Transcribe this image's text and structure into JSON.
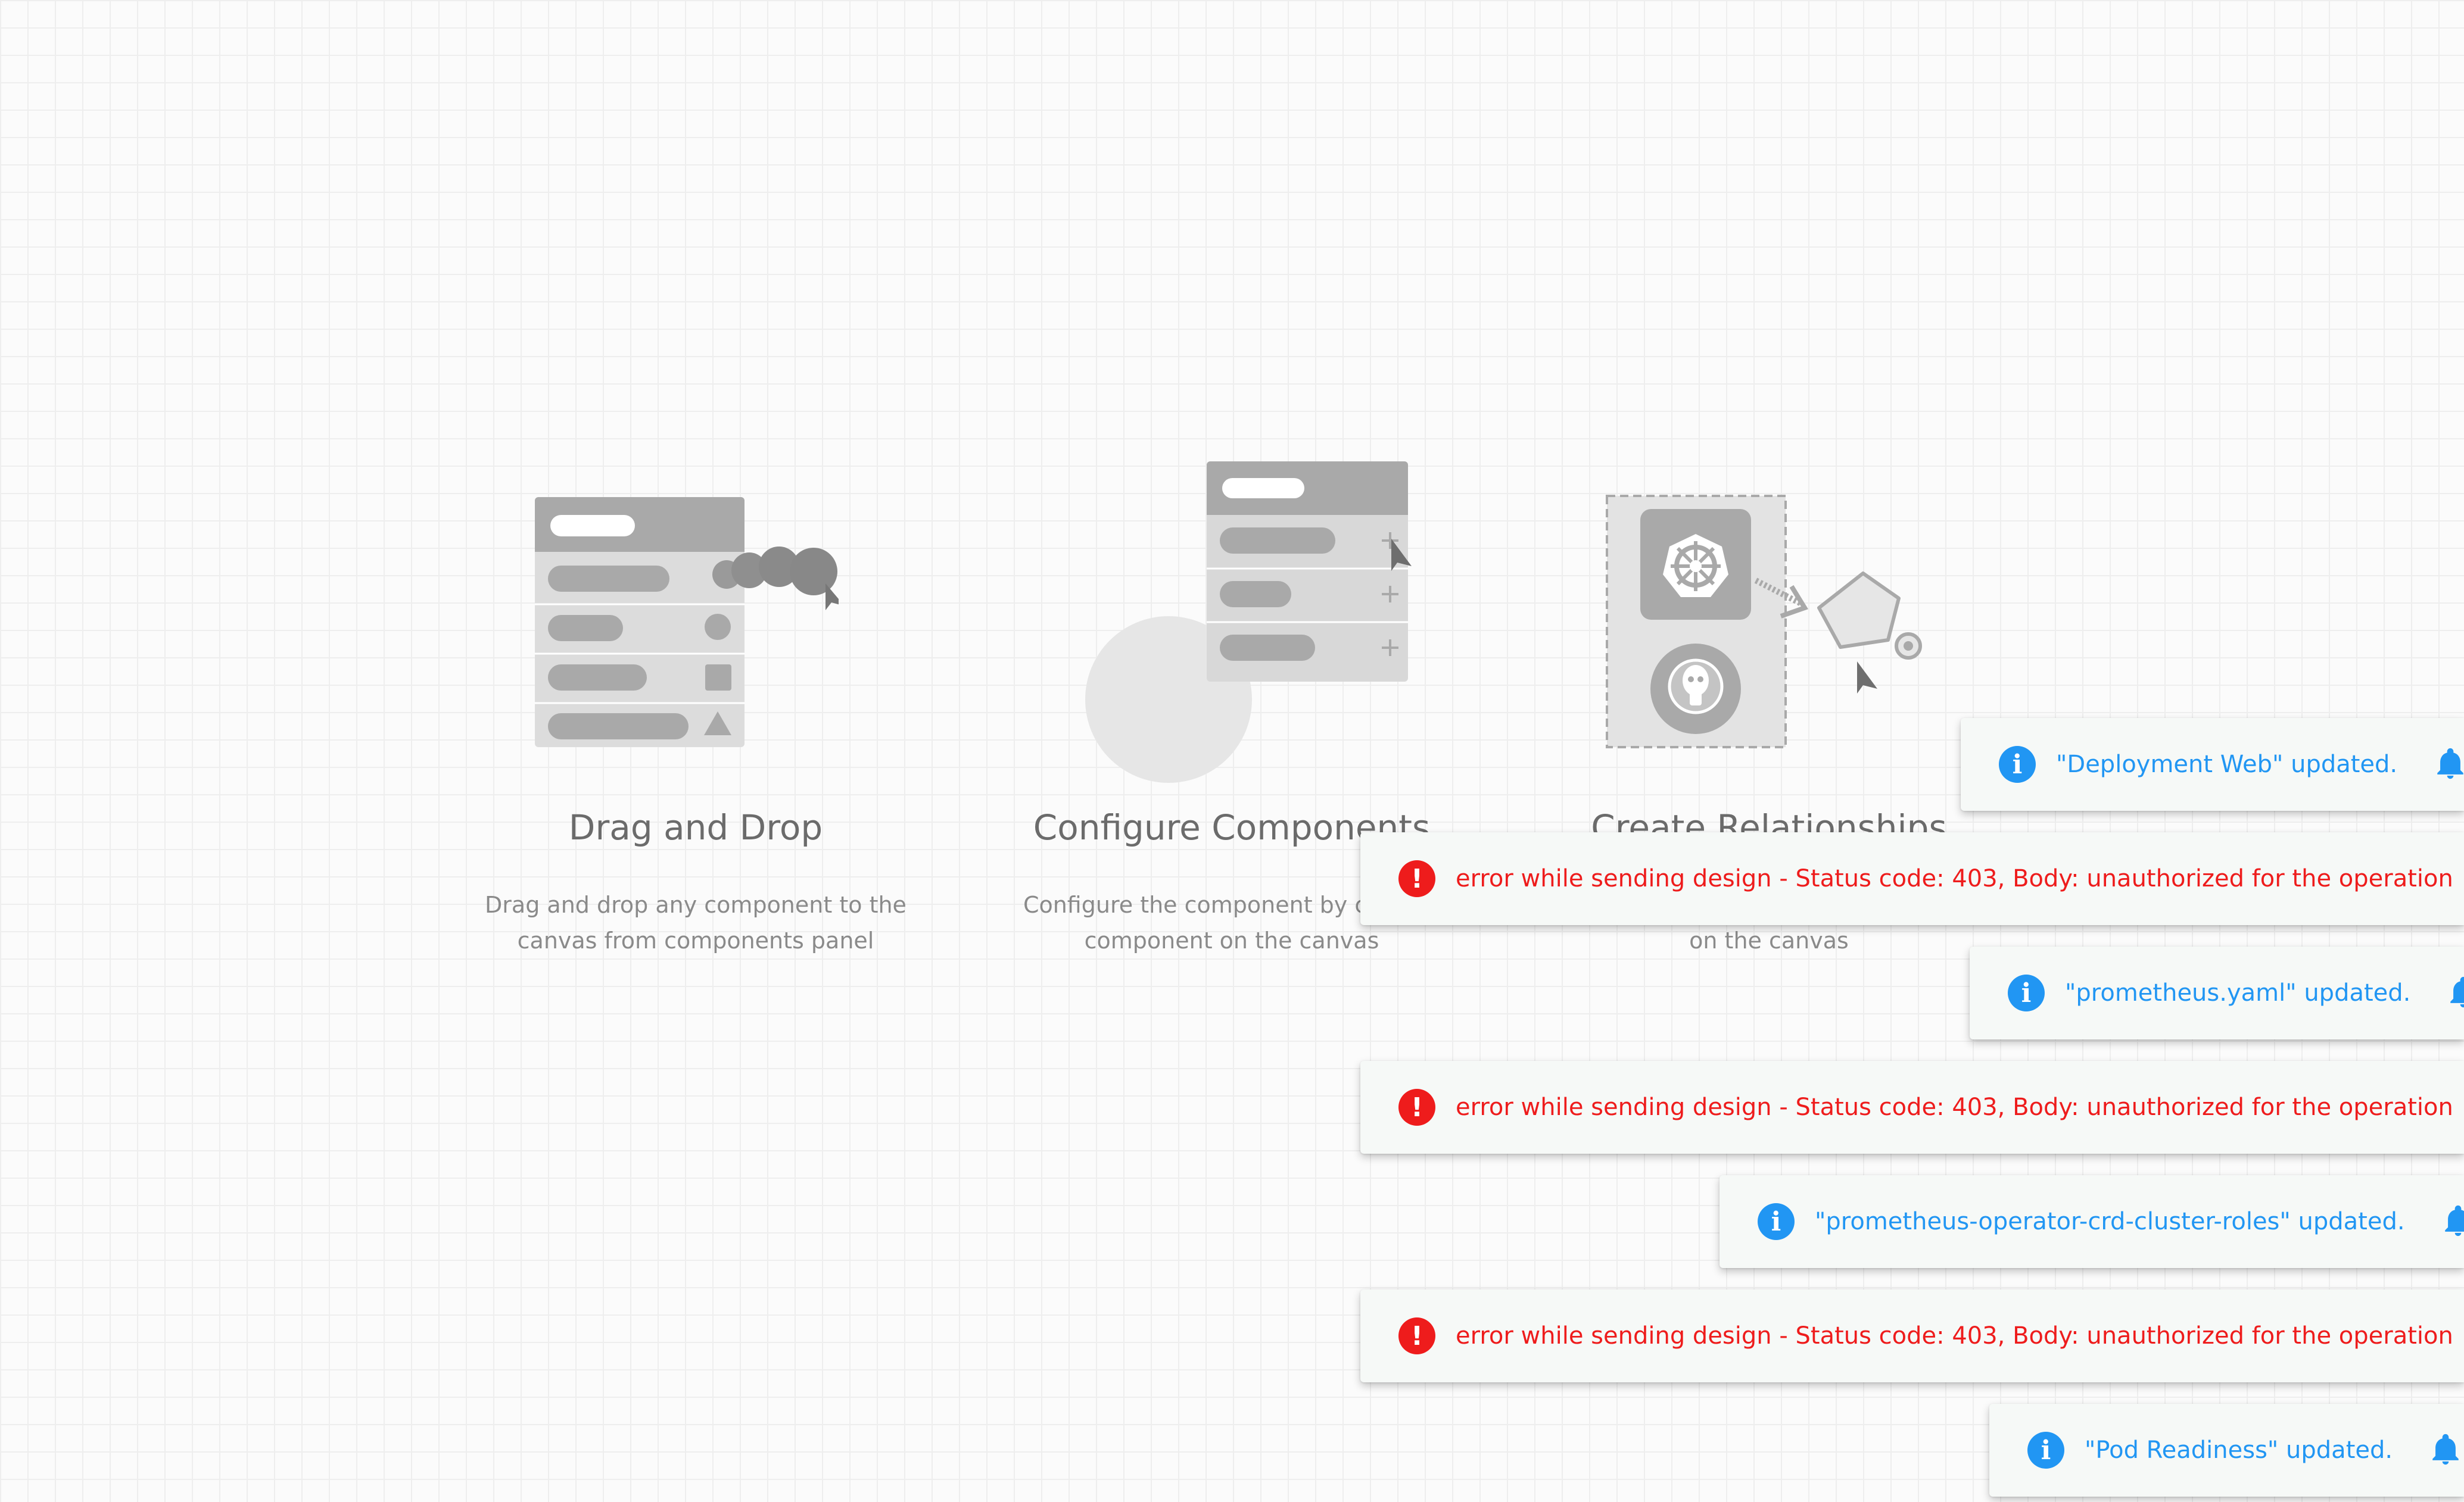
{
  "steps": [
    {
      "title": "Drag and Drop",
      "description": "Drag and drop any component to the\ncanvas from components panel"
    },
    {
      "title": "Configure Components",
      "description": "Configure the component by clicking\ncomponent on the canvas"
    },
    {
      "title": "Create Relationships",
      "description": "\non the canvas"
    }
  ],
  "notifications": [
    {
      "type": "info",
      "icon": "info-icon",
      "message": "\"Deployment Web\" updated."
    },
    {
      "type": "error",
      "icon": "error-icon",
      "message": "error while sending design - Status code: 403, Body: unauthorized for the operation"
    },
    {
      "type": "info",
      "icon": "info-icon",
      "message": "\"prometheus.yaml\" updated."
    },
    {
      "type": "error",
      "icon": "error-icon",
      "message": "error while sending design - Status code: 403, Body: unauthorized for the operation"
    },
    {
      "type": "info",
      "icon": "info-icon",
      "message": "\"prometheus-operator-crd-cluster-roles\" updated."
    },
    {
      "type": "error",
      "icon": "error-icon",
      "message": "error while sending design - Status code: 403, Body: unauthorized for the operation"
    },
    {
      "type": "info",
      "icon": "info-icon",
      "message": "\"Pod Readiness\" updated."
    }
  ],
  "colors": {
    "info": "#2196f3",
    "error": "#ee1c1c",
    "illustration_dark": "#a8a8a8",
    "illustration_light": "#d9d9d9"
  }
}
